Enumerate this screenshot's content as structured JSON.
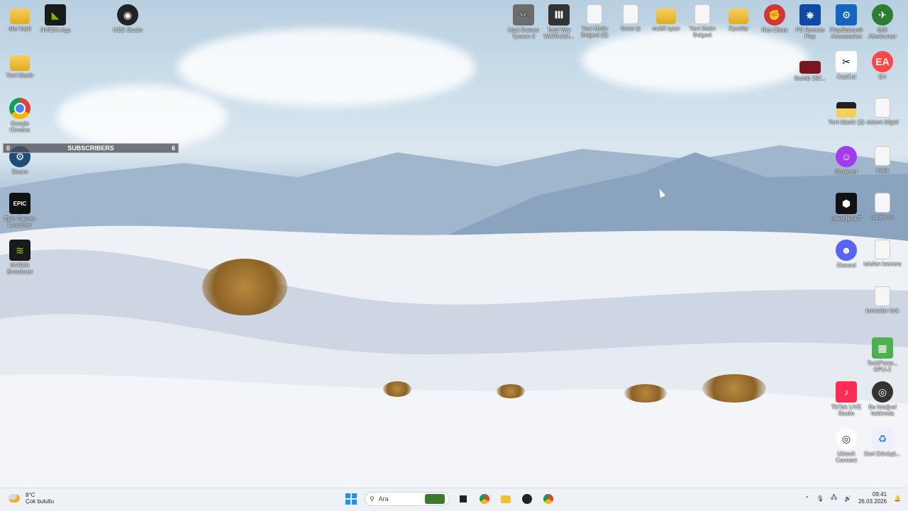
{
  "desktop_icons": [
    {
      "id": "obs-kayit",
      "label": "obs kayit",
      "icon": "folder-icon"
    },
    {
      "id": "nvidia-app",
      "label": "NVIDIA App",
      "icon": "nvidia-icon"
    },
    {
      "id": "obs-studio",
      "label": "OBS Studio",
      "icon": "obs-icon"
    },
    {
      "id": "yeni-klasor",
      "label": "Yeni klasör",
      "icon": "folder-icon"
    },
    {
      "id": "google-chrome",
      "label": "Google Chrome",
      "icon": "chrome-icon"
    },
    {
      "id": "steam",
      "label": "Steam",
      "icon": "steam-icon"
    },
    {
      "id": "epic",
      "label": "Epic Games Launcher",
      "icon": "epic-icon"
    },
    {
      "id": "nvidia-broadcast",
      "label": "NVIDIA Broadcast",
      "icon": "nvidia-broadcast-icon"
    },
    {
      "id": "mad-games",
      "label": "Mad Games Tycoon 2",
      "icon": "gamepad-icon"
    },
    {
      "id": "total-war",
      "label": "Total War WARHAM...",
      "icon": "total-war-icon"
    },
    {
      "id": "yeni-metin-2",
      "label": "Yeni Metin Belgesi (2)",
      "icon": "text-file-icon"
    },
    {
      "id": "fivem-ip",
      "label": "fivem ip",
      "icon": "text-file-icon"
    },
    {
      "id": "mobil-oyun",
      "label": "mobil oyun",
      "icon": "folder-icon"
    },
    {
      "id": "yeni-metin",
      "label": "Yeni Metin Belgesi",
      "icon": "text-file-icon"
    },
    {
      "id": "oyunlar",
      "label": "Oyunlar",
      "icon": "folder-icon"
    },
    {
      "id": "riot",
      "label": "Riot Client",
      "icon": "riot-icon"
    },
    {
      "id": "ps-remote",
      "label": "PS Remote Play",
      "icon": "ps-remote-icon"
    },
    {
      "id": "ps-accessories",
      "label": "PlayStation® Accessories",
      "icon": "ps-icon"
    },
    {
      "id": "msi-afterburner",
      "label": "MSI Afterburner",
      "icon": "msi-icon"
    },
    {
      "id": "thumb",
      "label": "thumb 192...",
      "icon": "image-file-icon"
    },
    {
      "id": "capcut",
      "label": "CapCut",
      "icon": "capcut-icon"
    },
    {
      "id": "ea",
      "label": "EA",
      "icon": "ea-icon"
    },
    {
      "id": "yeni-klasor-2",
      "label": "Yeni klasör (2)",
      "icon": "folder-icon"
    },
    {
      "id": "sistem-bilgisi",
      "label": "sistem bilgisi",
      "icon": "text-file-icon"
    },
    {
      "id": "gankster",
      "label": "Gankster",
      "icon": "gankster-icon"
    },
    {
      "id": "insta",
      "label": "insta",
      "icon": "text-file-icon"
    },
    {
      "id": "rekordbox",
      "label": "rekordbox 7",
      "icon": "rekordbox-icon"
    },
    {
      "id": "adobe-cc",
      "label": "adobe cc",
      "icon": "text-file-icon"
    },
    {
      "id": "discord",
      "label": "Discord",
      "icon": "discord-icon"
    },
    {
      "id": "telefon-kamera",
      "label": "telefon kamera",
      "icon": "text-file-icon"
    },
    {
      "id": "komutlar-kick",
      "label": "komutlar kick",
      "icon": "text-file-icon"
    },
    {
      "id": "techpowerup",
      "label": "TechPowe... GPU-Z",
      "icon": "gpuz-icon"
    },
    {
      "id": "tiktok-live",
      "label": "TikTok LIVE Studio",
      "icon": "tiktok-icon"
    },
    {
      "id": "bu-fotograf",
      "label": "Bu fotoğraf hakkında",
      "icon": "info-icon"
    },
    {
      "id": "ubisoft",
      "label": "Ubisoft Connect",
      "icon": "ubisoft-icon"
    },
    {
      "id": "geri-donusum",
      "label": "Geri Dönüşü...",
      "icon": "recycle-bin-icon"
    }
  ],
  "subscribers_widget": {
    "left": "0",
    "title": "SUBSCRIBERS",
    "right": "6"
  },
  "taskbar": {
    "weather_temp": "8°C",
    "weather_desc": "Çok bulutlu",
    "search_placeholder": "Ara",
    "time": "09:41",
    "date": "26.03.2026"
  },
  "colors": {
    "taskbar": "#eef1f5",
    "accent": "#0067c0"
  }
}
